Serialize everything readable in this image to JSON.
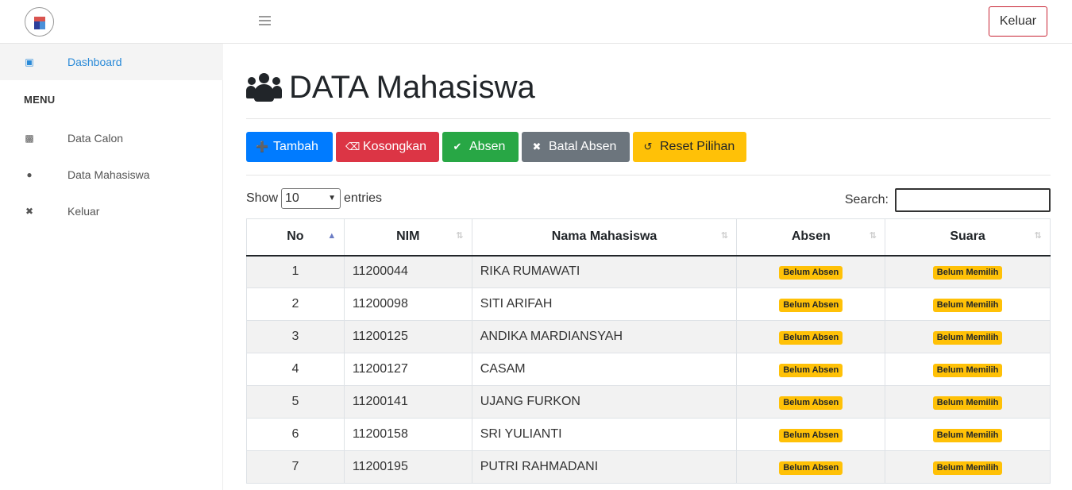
{
  "topbar": {
    "logout_label": "Keluar"
  },
  "sidebar": {
    "dashboard_label": "Dashboard",
    "menu_header": "MENU",
    "items": [
      {
        "label": "Data Calon"
      },
      {
        "label": "Data Mahasiswa"
      },
      {
        "label": "Keluar"
      }
    ]
  },
  "main": {
    "title": "DATA Mahasiswa",
    "buttons": {
      "tambah": "Tambah",
      "kosongkan": "Kosongkan",
      "absen": "Absen",
      "batal_absen": "Batal Absen",
      "reset_pilihan": "Reset Pilihan"
    },
    "length": {
      "show": "Show",
      "value": "10",
      "entries": "entries"
    },
    "search": {
      "label": "Search:"
    },
    "table": {
      "headers": [
        "No",
        "NIM",
        "Nama Mahasiswa",
        "Absen",
        "Suara"
      ],
      "rows": [
        {
          "no": "1",
          "nim": "11200044",
          "nama": "RIKA RUMAWATI",
          "absen": "Belum Absen",
          "suara": "Belum Memilih"
        },
        {
          "no": "2",
          "nim": "11200098",
          "nama": "SITI ARIFAH",
          "absen": "Belum Absen",
          "suara": "Belum Memilih"
        },
        {
          "no": "3",
          "nim": "11200125",
          "nama": "ANDIKA MARDIANSYAH",
          "absen": "Belum Absen",
          "suara": "Belum Memilih"
        },
        {
          "no": "4",
          "nim": "11200127",
          "nama": "CASAM",
          "absen": "Belum Absen",
          "suara": "Belum Memilih"
        },
        {
          "no": "5",
          "nim": "11200141",
          "nama": "UJANG FURKON",
          "absen": "Belum Absen",
          "suara": "Belum Memilih"
        },
        {
          "no": "6",
          "nim": "11200158",
          "nama": "SRI YULIANTI",
          "absen": "Belum Absen",
          "suara": "Belum Memilih"
        },
        {
          "no": "7",
          "nim": "11200195",
          "nama": "PUTRI RAHMADANI",
          "absen": "Belum Absen",
          "suara": "Belum Memilih"
        }
      ]
    }
  },
  "colors": {
    "primary": "#007bff",
    "danger": "#dc3545",
    "success": "#28a745",
    "secondary": "#6c757d",
    "warning": "#ffc107",
    "link": "#2a8ad8"
  }
}
